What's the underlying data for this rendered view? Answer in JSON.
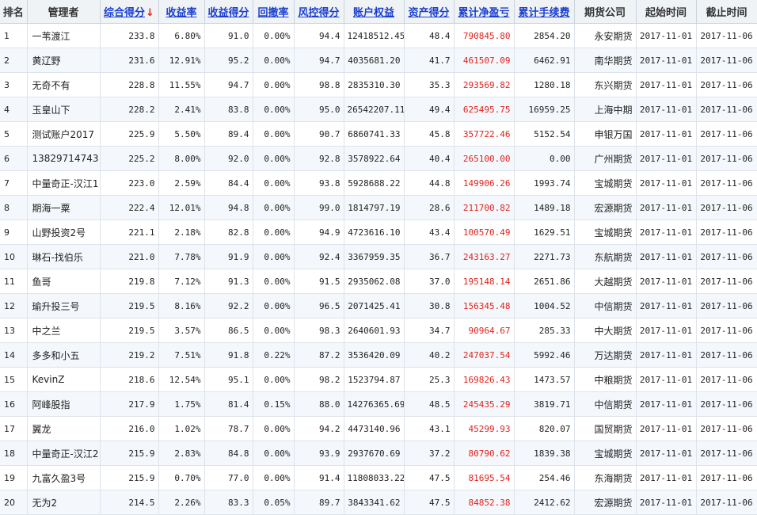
{
  "colors": {
    "sort_link": "#1a3fcf",
    "profit": "#e0221b",
    "header_bg": "#f0f3f6"
  },
  "headers": [
    {
      "label": "排名",
      "sortable": false
    },
    {
      "label": "管理者",
      "sortable": false
    },
    {
      "label": "综合得分",
      "sortable": true,
      "arrow": "↓"
    },
    {
      "label": "收益率",
      "sortable": true
    },
    {
      "label": "收益得分",
      "sortable": true
    },
    {
      "label": "回撤率",
      "sortable": true
    },
    {
      "label": "风控得分",
      "sortable": true
    },
    {
      "label": "账户权益",
      "sortable": true
    },
    {
      "label": "资产得分",
      "sortable": true
    },
    {
      "label": "累计净盈亏",
      "sortable": true
    },
    {
      "label": "累计手续费",
      "sortable": true
    },
    {
      "label": "期货公司",
      "sortable": false
    },
    {
      "label": "起始时间",
      "sortable": false
    },
    {
      "label": "截止时间",
      "sortable": false
    }
  ],
  "rows": [
    [
      "1",
      "一苇渡江",
      "233.8",
      "6.80%",
      "91.0",
      "0.00%",
      "94.4",
      "12418512.45",
      "48.4",
      "790845.80",
      "2854.20",
      "永安期货",
      "2017-11-01",
      "2017-11-06"
    ],
    [
      "2",
      "黄辽野",
      "231.6",
      "12.91%",
      "95.2",
      "0.00%",
      "94.7",
      "4035681.20",
      "41.7",
      "461507.09",
      "6462.91",
      "南华期货",
      "2017-11-01",
      "2017-11-06"
    ],
    [
      "3",
      "无奇不有",
      "228.8",
      "11.55%",
      "94.7",
      "0.00%",
      "98.8",
      "2835310.30",
      "35.3",
      "293569.82",
      "1280.18",
      "东兴期货",
      "2017-11-01",
      "2017-11-06"
    ],
    [
      "4",
      "玉皇山下",
      "228.2",
      "2.41%",
      "83.8",
      "0.00%",
      "95.0",
      "26542207.11",
      "49.4",
      "625495.75",
      "16959.25",
      "上海中期",
      "2017-11-01",
      "2017-11-06"
    ],
    [
      "5",
      "测试账户2017",
      "225.9",
      "5.50%",
      "89.4",
      "0.00%",
      "90.7",
      "6860741.33",
      "45.8",
      "357722.46",
      "5152.54",
      "申银万国",
      "2017-11-01",
      "2017-11-06"
    ],
    [
      "6",
      "13829714743",
      "225.2",
      "8.00%",
      "92.0",
      "0.00%",
      "92.8",
      "3578922.64",
      "40.4",
      "265100.00",
      "0.00",
      "广州期货",
      "2017-11-01",
      "2017-11-06"
    ],
    [
      "7",
      "中量奇正-汉江1",
      "223.0",
      "2.59%",
      "84.4",
      "0.00%",
      "93.8",
      "5928688.22",
      "44.8",
      "149906.26",
      "1993.74",
      "宝城期货",
      "2017-11-01",
      "2017-11-06"
    ],
    [
      "8",
      "期海一粟",
      "222.4",
      "12.01%",
      "94.8",
      "0.00%",
      "99.0",
      "1814797.19",
      "28.6",
      "211700.82",
      "1489.18",
      "宏源期货",
      "2017-11-01",
      "2017-11-06"
    ],
    [
      "9",
      "山野投资2号",
      "221.1",
      "2.18%",
      "82.8",
      "0.00%",
      "94.9",
      "4723616.10",
      "43.4",
      "100570.49",
      "1629.51",
      "宝城期货",
      "2017-11-01",
      "2017-11-06"
    ],
    [
      "10",
      "琳石-找伯乐",
      "221.0",
      "7.78%",
      "91.9",
      "0.00%",
      "92.4",
      "3367959.35",
      "36.7",
      "243163.27",
      "2271.73",
      "东航期货",
      "2017-11-01",
      "2017-11-06"
    ],
    [
      "11",
      "鱼哥",
      "219.8",
      "7.12%",
      "91.3",
      "0.00%",
      "91.5",
      "2935062.08",
      "37.0",
      "195148.14",
      "2651.86",
      "大越期货",
      "2017-11-01",
      "2017-11-06"
    ],
    [
      "12",
      "瑜升投三号",
      "219.5",
      "8.16%",
      "92.2",
      "0.00%",
      "96.5",
      "2071425.41",
      "30.8",
      "156345.48",
      "1004.52",
      "中信期货",
      "2017-11-01",
      "2017-11-06"
    ],
    [
      "13",
      "中之兰",
      "219.5",
      "3.57%",
      "86.5",
      "0.00%",
      "98.3",
      "2640601.93",
      "34.7",
      "90964.67",
      "285.33",
      "中大期货",
      "2017-11-01",
      "2017-11-06"
    ],
    [
      "14",
      "多多和小五",
      "219.2",
      "7.51%",
      "91.8",
      "0.22%",
      "87.2",
      "3536420.09",
      "40.2",
      "247037.54",
      "5992.46",
      "万达期货",
      "2017-11-01",
      "2017-11-06"
    ],
    [
      "15",
      "KevinZ",
      "218.6",
      "12.54%",
      "95.1",
      "0.00%",
      "98.2",
      "1523794.87",
      "25.3",
      "169826.43",
      "1473.57",
      "中粮期货",
      "2017-11-01",
      "2017-11-06"
    ],
    [
      "16",
      "阿峰股指",
      "217.9",
      "1.75%",
      "81.4",
      "0.15%",
      "88.0",
      "14276365.69",
      "48.5",
      "245435.29",
      "3819.71",
      "中信期货",
      "2017-11-01",
      "2017-11-06"
    ],
    [
      "17",
      "翼龙",
      "216.0",
      "1.02%",
      "78.7",
      "0.00%",
      "94.2",
      "4473140.96",
      "43.1",
      "45299.93",
      "820.07",
      "国贸期货",
      "2017-11-01",
      "2017-11-06"
    ],
    [
      "18",
      "中量奇正-汉江2",
      "215.9",
      "2.83%",
      "84.8",
      "0.00%",
      "93.9",
      "2937670.69",
      "37.2",
      "80790.62",
      "1839.38",
      "宝城期货",
      "2017-11-01",
      "2017-11-06"
    ],
    [
      "19",
      "九富久盈3号",
      "215.9",
      "0.70%",
      "77.0",
      "0.00%",
      "91.4",
      "11808033.22",
      "47.5",
      "81695.54",
      "254.46",
      "东海期货",
      "2017-11-01",
      "2017-11-06"
    ],
    [
      "20",
      "无为2",
      "214.5",
      "2.26%",
      "83.3",
      "0.05%",
      "89.7",
      "3843341.62",
      "47.5",
      "84852.38",
      "2412.62",
      "宏源期货",
      "2017-11-01",
      "2017-11-06"
    ]
  ]
}
